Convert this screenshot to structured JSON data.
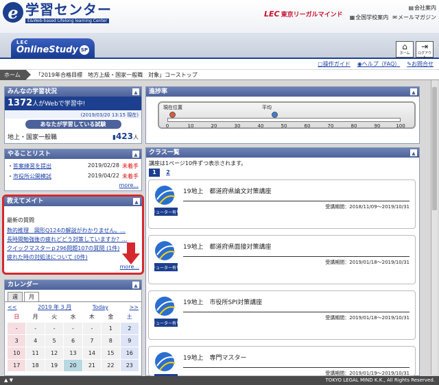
{
  "header": {
    "logo_letter": "e",
    "title": "学習センター",
    "subtitle": "E&Web-based Lifelong learning Center",
    "lec_mark": "LEC",
    "lec_name": "東京リーガルマインド",
    "company_info": "会社案内",
    "schools": "全国学校案内",
    "magazine": "メールマガジン"
  },
  "brand": {
    "lec": "LEC",
    "name": "OnlineStudy",
    "badge": "SP",
    "home_label": "ホーム",
    "logout_label": "ログアウト"
  },
  "util": {
    "guide": "操作ガイド",
    "help": "ヘルプ（FAQ）",
    "contact": "お問合せ"
  },
  "breadcrumb": {
    "home": "ホーム",
    "current": "「2019年合格目標　地方上級・国家一般職　対象」コーストップ"
  },
  "study_status": {
    "title": "みんなの学習状況",
    "count": "1372",
    "count_suffix": "人がWebで学習中!",
    "timestamp": "(2019/03/20 13:15 現在)",
    "exam_pill": "あなたが学習している試験",
    "exam_name": "地上・国家一般職",
    "exam_count": "423",
    "exam_unit": "人"
  },
  "todo": {
    "title": "やることリスト",
    "items": [
      {
        "label": "答案練習を提出",
        "date": "2019/02/28",
        "state": "未着手"
      },
      {
        "label": "市役所公開模試",
        "date": "2019/04/22",
        "state": "未着手"
      }
    ],
    "more": "more..."
  },
  "qa": {
    "title": "教えてメイト",
    "label": "最新の質問",
    "items": [
      "数的推理　図形Q124の解説がわかりません。...",
      "長時間勉強後の疲れどどう対策していますか？...",
      "クイックマスターｐ296問題107の質問 (1件)",
      "疲れた時の対処法について (0件)"
    ],
    "more": "more..."
  },
  "calendar": {
    "title": "カレンダー",
    "tab_week": "週",
    "tab_month": "月",
    "prev": "<<",
    "month": "2019 年 3 月",
    "today": "Today",
    "next": ">>",
    "dow": [
      "日",
      "月",
      "火",
      "水",
      "木",
      "金",
      "土"
    ],
    "days": [
      "-",
      "-",
      "-",
      "-",
      "-",
      "1",
      "2",
      "3",
      "4",
      "5",
      "6",
      "7",
      "8",
      "9",
      "10",
      "11",
      "12",
      "13",
      "14",
      "15",
      "16",
      "17",
      "18",
      "19",
      "20",
      "21",
      "22",
      "23"
    ]
  },
  "progress": {
    "title": "進捗率",
    "current_label": "現在位置",
    "average_label": "平均",
    "current_value": 2,
    "average_value": 46,
    "ticks": [
      "0",
      "10",
      "20",
      "30",
      "40",
      "50",
      "60",
      "70",
      "80",
      "90",
      "100"
    ],
    "colors": {
      "current": "#e05a3a",
      "average": "#3a7fd0"
    }
  },
  "classes": {
    "title": "クラス一覧",
    "info": "講座は1ページ10件ずつ表示されます。",
    "pages": [
      "1",
      "2"
    ],
    "icon_label": "チューター有り",
    "items": [
      {
        "name": "19地上　都道府県論文対策講座",
        "period": "受講期間：2018/11/09～2019/10/31"
      },
      {
        "name": "19地上　都道府県面接対策講座",
        "period": "受講期間：2019/01/18～2019/10/31"
      },
      {
        "name": "19地上　市役所SPI対策講座",
        "period": "受講期間：2019/01/18～2019/10/31"
      },
      {
        "name": "19地上　専門マスター",
        "period": "受講期間：2019/01/19～2019/10/31"
      }
    ]
  },
  "footer": {
    "copyright": "TOKYO LEGAL MIND K.K., All Rights Reserved."
  }
}
